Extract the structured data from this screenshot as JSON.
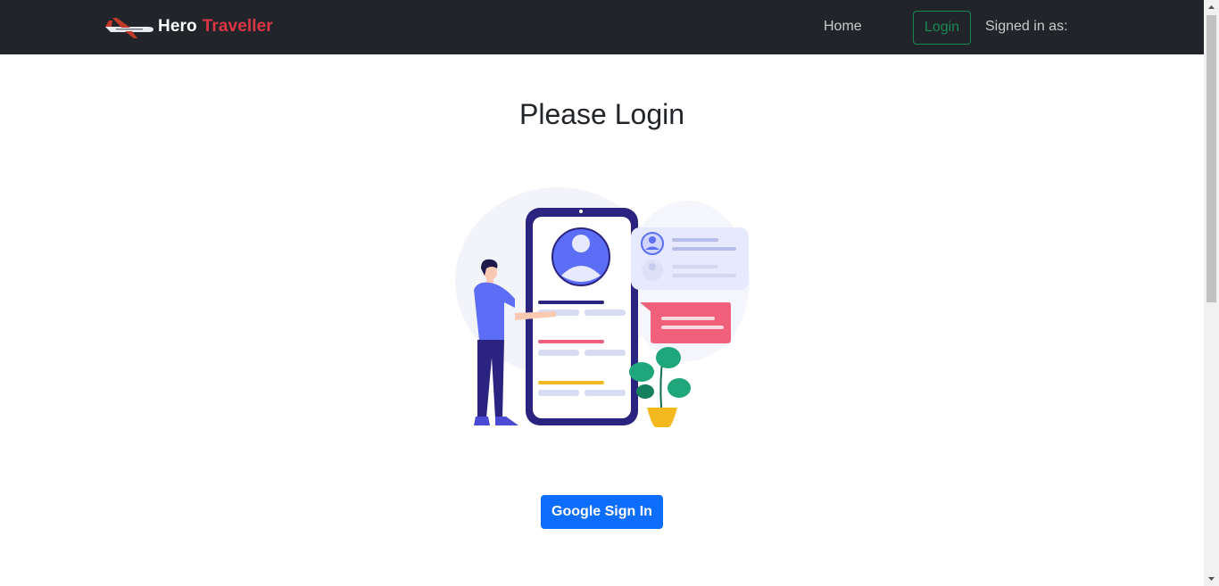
{
  "navbar": {
    "brand_part1": "Hero",
    "brand_part2": "Traveller",
    "home_label": "Home",
    "login_label": "Login",
    "signed_in_label": "Signed in as:"
  },
  "main": {
    "title": "Please Login",
    "google_button_label": "Google Sign In"
  },
  "colors": {
    "navbar_bg": "#212529",
    "brand_accent": "#dc3545",
    "login_outline": "#198754",
    "primary_button": "#0d6efd"
  },
  "icons": {
    "logo": "airplane-icon",
    "illustration": "login-illustration"
  }
}
